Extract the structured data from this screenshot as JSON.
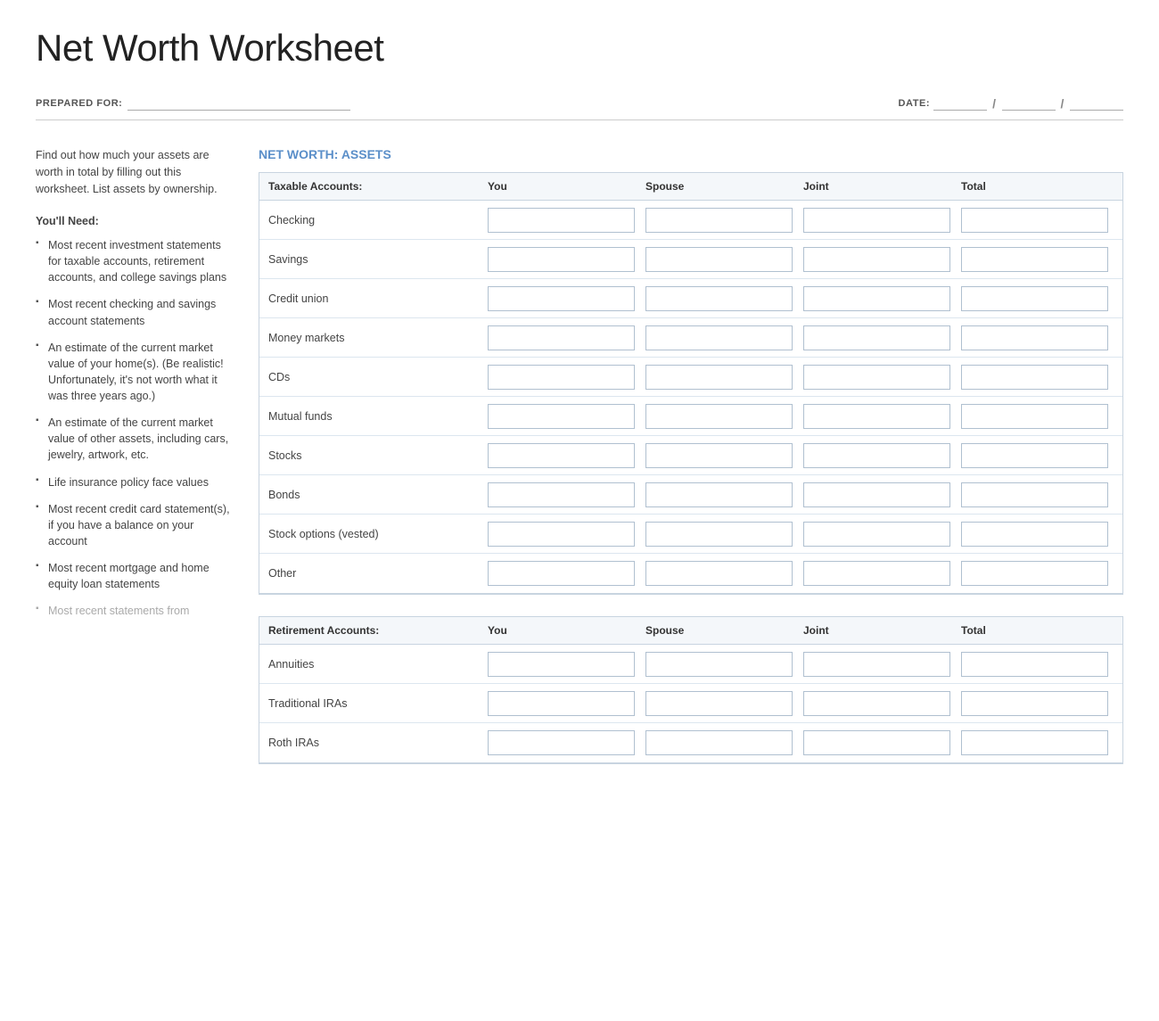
{
  "title": "Net Worth Worksheet",
  "header": {
    "prepared_for_label": "PREPARED FOR:",
    "date_label": "DATE:"
  },
  "sidebar": {
    "intro": "Find out how much your assets are worth in total by filling out this worksheet. List assets by ownership.",
    "youll_need_label": "You'll Need",
    "items": [
      {
        "text": "Most recent investment statements for taxable accounts, retirement accounts, and college savings plans",
        "faded": false
      },
      {
        "text": "Most recent checking and savings account statements",
        "faded": false
      },
      {
        "text": "An estimate of the current market value of your home(s). (Be realistic! Unfortunately, it's not worth what it was three years ago.)",
        "faded": false
      },
      {
        "text": "An estimate of the current market value of other assets, including cars, jewelry, artwork, etc.",
        "faded": false
      },
      {
        "text": "Life insurance policy face values",
        "faded": false
      },
      {
        "text": "Most recent credit card statement(s), if you have a balance on your account",
        "faded": false
      },
      {
        "text": "Most recent mortgage and home equity loan statements",
        "faded": false
      },
      {
        "text": "Most recent statements from",
        "faded": true
      }
    ]
  },
  "net_worth_label": "NET WORTH:",
  "assets_label": "ASSETS",
  "taxable_accounts": {
    "section_label": "Taxable Accounts:",
    "col_you": "You",
    "col_spouse": "Spouse",
    "col_joint": "Joint",
    "col_total": "Total",
    "rows": [
      "Checking",
      "Savings",
      "Credit union",
      "Money markets",
      "CDs",
      "Mutual funds",
      "Stocks",
      "Bonds",
      "Stock options (vested)",
      "Other"
    ]
  },
  "retirement_accounts": {
    "section_label": "Retirement Accounts:",
    "col_you": "You",
    "col_spouse": "Spouse",
    "col_joint": "Joint",
    "col_total": "Total",
    "rows": [
      "Annuities",
      "Traditional IRAs",
      "Roth IRAs"
    ]
  }
}
